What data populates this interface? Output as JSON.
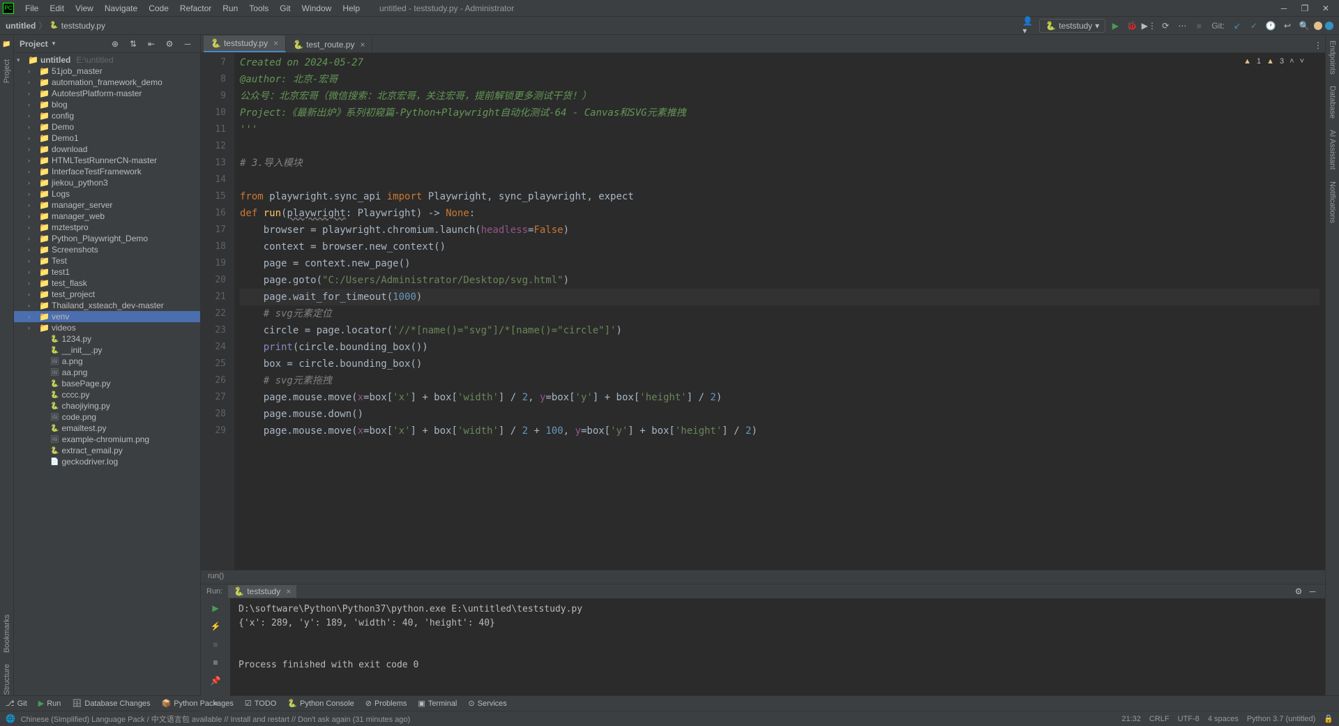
{
  "window": {
    "title": "untitled - teststudy.py - Administrator"
  },
  "menu": {
    "file": "File",
    "edit": "Edit",
    "view": "View",
    "navigate": "Navigate",
    "code": "Code",
    "refactor": "Refactor",
    "run": "Run",
    "tools": "Tools",
    "git": "Git",
    "window": "Window",
    "help": "Help"
  },
  "breadcrumb": {
    "root": "untitled",
    "file": "teststudy.py"
  },
  "run_config": {
    "name": "teststudy",
    "git_label": "Git:"
  },
  "project": {
    "header": "Project",
    "root": "untitled",
    "root_path": "E:\\untitled",
    "folders": [
      "51job_master",
      "automation_framework_demo",
      "AutotestPlatform-master",
      "blog",
      "config",
      "Demo",
      "Demo1",
      "download",
      "HTMLTestRunnerCN-master",
      "InterfaceTestFramework",
      "jiekou_python3",
      "Logs",
      "manager_server",
      "manager_web",
      "mztestpro",
      "Python_Playwright_Demo",
      "Screenshots",
      "Test",
      "test1",
      "test_flask",
      "test_project",
      "Thailand_xsteach_dev-master",
      "venv",
      "videos"
    ],
    "files": [
      "1234.py",
      "__init__.py",
      "a.png",
      "aa.png",
      "basePage.py",
      "cccc.py",
      "chaojiying.py",
      "code.png",
      "emailtest.py",
      "example-chromium.png",
      "extract_email.py",
      "geckodriver.log"
    ]
  },
  "tabs": {
    "t1": "teststudy.py",
    "t2": "test_route.py"
  },
  "editor": {
    "line_start": 7,
    "lines": [
      {
        "n": 7,
        "cls": "c-doc",
        "t": "Created on 2024-05-27"
      },
      {
        "n": 8,
        "cls": "c-doc",
        "t": "@author: 北京-宏哥"
      },
      {
        "n": 9,
        "cls": "c-doc",
        "t": "公众号：北京宏哥（微信搜索：北京宏哥，关注宏哥，提前解锁更多测试干货！）"
      },
      {
        "n": 10,
        "cls": "c-doc",
        "t": "Project:《最新出炉》系列初窥篇-Python+Playwright自动化测试-64 - Canvas和SVG元素推拽"
      },
      {
        "n": 11,
        "cls": "c-doc",
        "t": "'''"
      },
      {
        "n": 12,
        "cls": "",
        "t": ""
      },
      {
        "n": 13,
        "cls": "c-comment",
        "t": "# 3.导入模块"
      },
      {
        "n": 14,
        "cls": "",
        "t": ""
      }
    ],
    "crumb": "run()",
    "warnings": "1",
    "errors": "3"
  },
  "run": {
    "title": "Run:",
    "tab": "teststudy",
    "output": "D:\\software\\Python\\Python37\\python.exe E:\\untitled\\teststudy.py\n{'x': 289, 'y': 189, 'width': 40, 'height': 40}\n\n\nProcess finished with exit code 0"
  },
  "bottom": {
    "git": "Git",
    "run": "Run",
    "db": "Database Changes",
    "pkg": "Python Packages",
    "todo": "TODO",
    "console": "Python Console",
    "problems": "Problems",
    "terminal": "Terminal",
    "services": "Services"
  },
  "status": {
    "msg": "Chinese (Simplified) Language Pack / 中文语言包 available // Install and restart // Don't ask again (31 minutes ago)",
    "pos": "21:32",
    "sep": "CRLF",
    "enc": "UTF-8",
    "indent": "4 spaces",
    "interp": "Python 3.7 (untitled)"
  },
  "side": {
    "project": "Project",
    "bookmarks": "Bookmarks",
    "structure": "Structure",
    "endpoints": "Endpoints",
    "database": "Database",
    "ai": "AI Assistant",
    "notifications": "Notifications"
  }
}
